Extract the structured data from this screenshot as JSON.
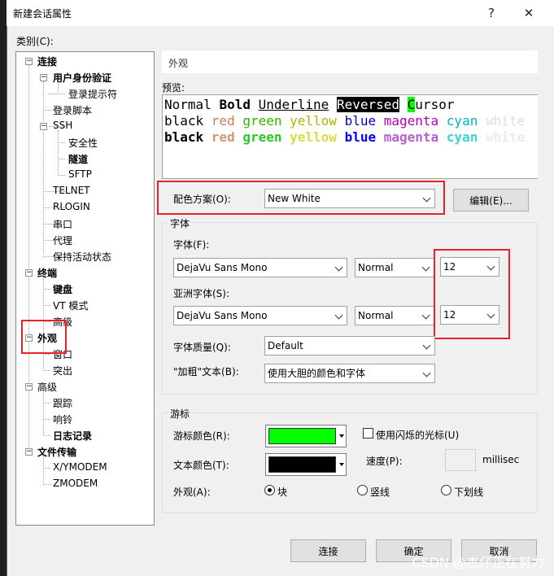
{
  "window": {
    "title": "新建会话属性",
    "help": "?",
    "close": "✕"
  },
  "category_label": "类别(C):",
  "tree": {
    "connection": "连接",
    "auth": "用户身份验证",
    "login_prompt": "登录提示符",
    "login_script": "登录脚本",
    "ssh": "SSH",
    "security": "安全性",
    "tunnel": "隧道",
    "sftp": "SFTP",
    "telnet": "TELNET",
    "rlogin": "RLOGIN",
    "serial": "串口",
    "proxy": "代理",
    "keepalive": "保持活动状态",
    "terminal": "终端",
    "keyboard": "键盘",
    "vt_mode": "VT 模式",
    "advanced": "高级",
    "appearance": "外观",
    "window": "窗口",
    "highlight": "突出",
    "advanced2": "高级",
    "trace": "跟踪",
    "bell": "响铃",
    "logging": "日志记录",
    "file_transfer": "文件传输",
    "xymodem": "X/YMODEM",
    "zmodem": "ZMODEM"
  },
  "header": "外观",
  "preview": {
    "label": "预览:",
    "line1": {
      "normal": "Normal ",
      "bold": "Bold",
      "underline": "Underline",
      "reversed": "Reversed",
      "cursor_char": "C",
      "cursor_rest": "ursor"
    },
    "colors": [
      "black",
      "red",
      "green",
      "yellow",
      "blue",
      "magenta",
      "cyan",
      "white"
    ]
  },
  "scheme": {
    "label": "配色方案(O):",
    "value": "New White",
    "edit_button": "编辑(E)..."
  },
  "font_group": {
    "title": "字体",
    "font_label": "字体(F):",
    "font_value": "DejaVu Sans Mono",
    "weight_value": "Normal",
    "size_value": "12",
    "asian_label": "亚洲字体(S):",
    "asian_font_value": "DejaVu Sans Mono",
    "asian_weight_value": "Normal",
    "asian_size_value": "12",
    "quality_label": "字体质量(Q):",
    "quality_value": "Default",
    "bold_label": "\"加粗\"文本(B):",
    "bold_value": "使用大胆的颜色和字体"
  },
  "cursor_group": {
    "title": "游标",
    "cursor_color_label": "游标颜色(R):",
    "cursor_color": "#00ff00",
    "blink_label": "使用闪烁的光标(U)",
    "text_color_label": "文本颜色(T):",
    "text_color": "#000000",
    "speed_label": "速度(P):",
    "speed_unit": "millisec",
    "shape_label": "外观(A):",
    "shape_block": "块",
    "shape_vline": "竖线",
    "shape_underline": "下划线"
  },
  "buttons": {
    "connect": "连接",
    "ok": "确定",
    "cancel": "取消"
  },
  "watermark": "CSDN @杰仔正在努力"
}
